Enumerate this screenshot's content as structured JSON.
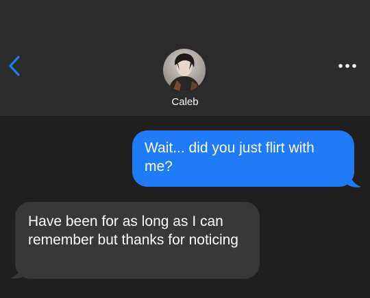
{
  "header": {
    "contact_name": "Caleb",
    "back_icon": "chevron-left-icon",
    "more_icon": "more-horizontal-icon",
    "accent_color": "#1f7cf6"
  },
  "messages": [
    {
      "direction": "outgoing",
      "text": "Wait... did you just flirt with me?",
      "bubble_color": "#1f7cf6"
    },
    {
      "direction": "incoming",
      "text": "Have been for as long as I can remember but thanks for noticing",
      "bubble_color": "#383838"
    }
  ]
}
